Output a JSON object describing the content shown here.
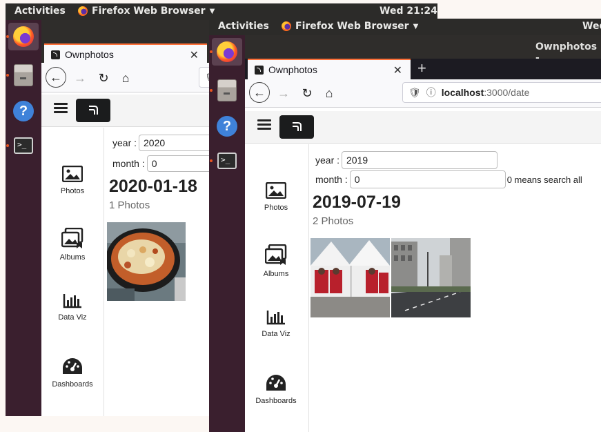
{
  "desktop": {
    "activities": "Activities",
    "app_name": "Firefox Web Browser",
    "clock_back": "Wed 21:24",
    "clock_front": "Wed"
  },
  "window": {
    "title": "Ownphotos -"
  },
  "browser": {
    "tab_title": "Ownphotos",
    "url_host": "localhost",
    "url_path": ":3000/date"
  },
  "sidebar": {
    "items": [
      {
        "label": "Photos",
        "icon": "photo-icon"
      },
      {
        "label": "Albums",
        "icon": "albums-icon"
      },
      {
        "label": "Data Viz",
        "icon": "bar-chart-icon"
      },
      {
        "label": "Dashboards",
        "icon": "dashboard-icon"
      }
    ]
  },
  "back_window": {
    "year_label": "year :",
    "year_value": "2020",
    "month_label": "month :",
    "month_value": "0",
    "date_heading": "2020-01-18",
    "photo_count": "1 Photos"
  },
  "front_window": {
    "year_label": "year :",
    "year_value": "2019",
    "month_label": "month :",
    "month_value": "0",
    "month_hint": "0 means search all",
    "date_heading": "2019-07-19",
    "photo_count": "2 Photos"
  },
  "colors": {
    "dock": "#3a1f2e",
    "topbar": "#2c2b29",
    "tab_accent": "#ff7139"
  }
}
